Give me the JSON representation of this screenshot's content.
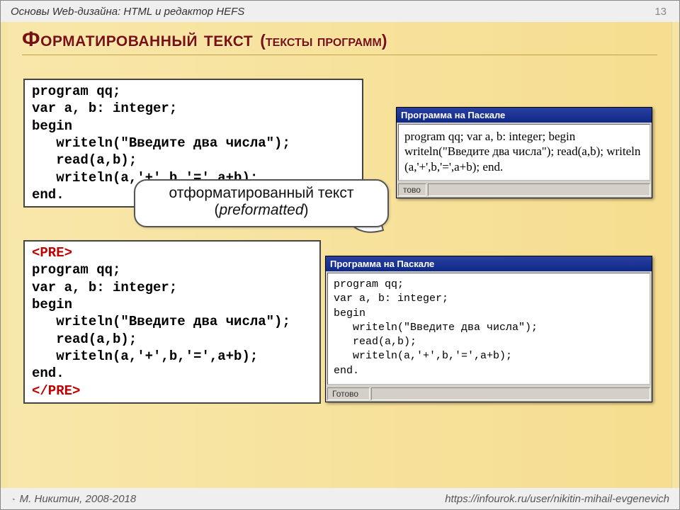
{
  "header": {
    "breadcrumb": "Основы Web-дизайна: HTML и редактор HEFS",
    "page_number": "13"
  },
  "title": {
    "main": "Форматированный текст",
    "sub": "(тексты программ)"
  },
  "code1": "program qq;\nvar a, b: integer;\nbegin\n   writeln(\"Введите два числа\");\n   read(a,b);\n   writeln(a,'+',b,'=',a+b);\nend.",
  "code2_open": "<PRE>",
  "code2_body": "program qq;\nvar a, b: integer;\nbegin\n   writeln(\"Введите два числа\");\n   read(a,b);\n   writeln(a,'+',b,'=',a+b);\nend.",
  "code2_close": "</PRE>",
  "callout": {
    "line1": "отформатированный текст",
    "line2_open": "(",
    "line2_em": "preformatted",
    "line2_close": ")"
  },
  "window1": {
    "title": "Программа на Паскале",
    "body": "program qq; var a, b: integer; begin writeln(\"Введите два числа\"); read(a,b); writeln (a,'+',b,'=',a+b); end.",
    "status": "тово"
  },
  "window2": {
    "title": "Программа на Паскале",
    "body": "program qq;\nvar a, b: integer;\nbegin\n   writeln(\"Введите два числа\");\n   read(a,b);\n   writeln(a,'+',b,'=',a+b);\nend.",
    "status": "Готово"
  },
  "footer": {
    "left": "М. Никитин, 2008-2018",
    "right": "https://infourok.ru/user/nikitin-mihail-evgenevich"
  }
}
